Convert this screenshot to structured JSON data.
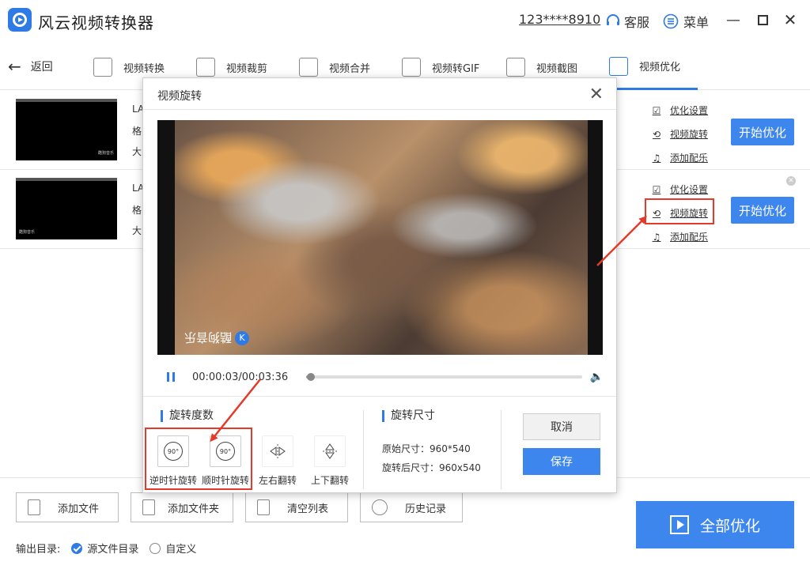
{
  "app": {
    "title": "风云视频转换器",
    "account": "123****8910",
    "service_label": "客服",
    "menu_label": "菜单"
  },
  "toolbar": {
    "back_label": "返回",
    "tools": [
      "视频转换",
      "视频裁剪",
      "视频合并",
      "视频转GIF",
      "视频截图",
      "视频优化"
    ],
    "active": "视频优化"
  },
  "files": [
    {
      "name": "LA",
      "format": "格",
      "size": "大",
      "thumb_tag": "酷狗音乐",
      "options": [
        "优化设置",
        "视频旋转",
        "添加配乐"
      ],
      "start_label": "开始优化"
    },
    {
      "name": "LA",
      "format": "格",
      "size": "大",
      "thumb_tag": "酷狗音乐",
      "options": [
        "优化设置",
        "视频旋转",
        "添加配乐"
      ],
      "start_label": "开始优化"
    }
  ],
  "bottom": {
    "buttons": [
      "添加文件",
      "添加文件夹",
      "清空列表",
      "历史记录"
    ],
    "output_label": "输出目录:",
    "output_options": [
      "源文件目录",
      "自定义"
    ],
    "output_selected": "源文件目录",
    "all_label": "全部优化"
  },
  "dialog": {
    "title": "视频旋转",
    "watermark": "酷狗音乐",
    "time": "00:00:03/00:03:36",
    "progress": 0.015,
    "rotation_title": "旋转度数",
    "rotate_buttons": [
      {
        "label": "逆时针旋转",
        "glyph": "90°"
      },
      {
        "label": "顺时针旋转",
        "glyph": "90°"
      },
      {
        "label": "左右翻转",
        "glyph": ""
      },
      {
        "label": "上下翻转",
        "glyph": ""
      }
    ],
    "size_title": "旋转尺寸",
    "original_size": "原始尺寸：960*540",
    "rotated_size": "旋转后尺寸：960x540",
    "cancel_label": "取消",
    "save_label": "保存"
  },
  "colors": {
    "accent": "#3d86ee",
    "annotation": "#e53a2a"
  }
}
